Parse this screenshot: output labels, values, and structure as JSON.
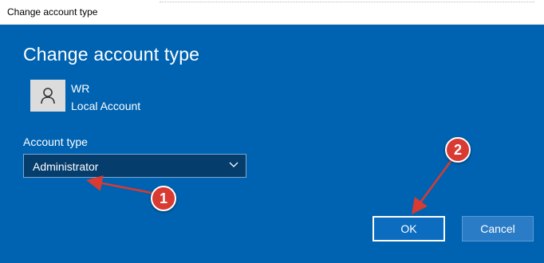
{
  "window": {
    "title": "Change account type"
  },
  "dialog": {
    "heading": "Change account type",
    "user": {
      "name": "WR",
      "type": "Local Account",
      "avatar_icon": "user-silhouette-icon"
    },
    "account_type": {
      "label": "Account type",
      "selected": "Administrator"
    },
    "buttons": {
      "ok": "OK",
      "cancel": "Cancel"
    }
  },
  "annotations": {
    "step1": "1",
    "step2": "2"
  },
  "colors": {
    "dialog_bg": "#0063b1",
    "dropdown_bg": "#053d6d",
    "callout_red": "#d93a32"
  }
}
